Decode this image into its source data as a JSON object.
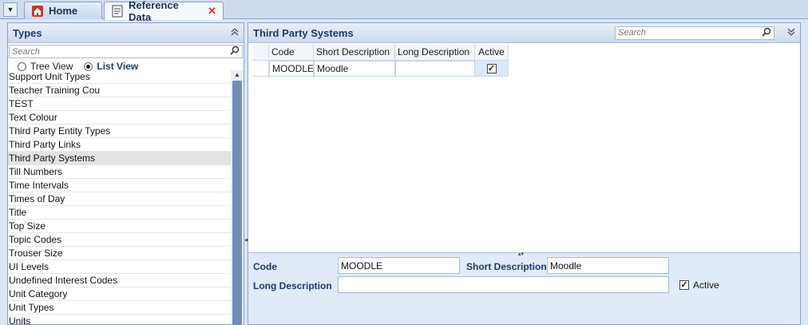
{
  "tabs": {
    "menu_glyph": "▼",
    "home_label": "Home",
    "reference_label": "Reference Data",
    "close_glyph": "✕"
  },
  "left": {
    "title": "Types",
    "search_placeholder": "Search",
    "tree_view_label": "Tree View",
    "list_view_label": "List View",
    "selected_view": "List View",
    "items": [
      "Support Unit Types",
      "Teacher Training Cou",
      "TEST",
      "Text Colour",
      "Third Party Entity Types",
      "Third Party Links",
      "Third Party Systems",
      "Till Numbers",
      "Time Intervals",
      "Times of Day",
      "Title",
      "Top Size",
      "Topic Codes",
      "Trouser Size",
      "UI Levels",
      "Undefined Interest Codes",
      "Unit Category",
      "Unit Types",
      "Units"
    ],
    "selected_item": "Third Party Systems"
  },
  "right": {
    "title": "Third Party Systems",
    "search_placeholder": "Search",
    "columns": [
      "Code",
      "Short Description",
      "Long Description",
      "Active"
    ],
    "rows": [
      {
        "code": "MOODLE",
        "short": "Moodle",
        "long": "",
        "active": "✓"
      }
    ],
    "detail": {
      "code_label": "Code",
      "code_value": "MOODLE",
      "short_label": "Short Description",
      "short_value": "Moodle",
      "long_label": "Long Description",
      "long_value": "",
      "active_label": "Active",
      "active_mark": "✓"
    }
  },
  "icons": {
    "home": "home-icon",
    "reference": "document-icon",
    "search": "search-icon",
    "collapse": "double-chevron-up-icon",
    "expand": "double-chevron-down-icon"
  },
  "colors": {
    "accent": "#1e3a6e",
    "selected_row": "#e3e3e3",
    "scroll_thumb": "#6f8fb8",
    "close": "#dd3333"
  }
}
